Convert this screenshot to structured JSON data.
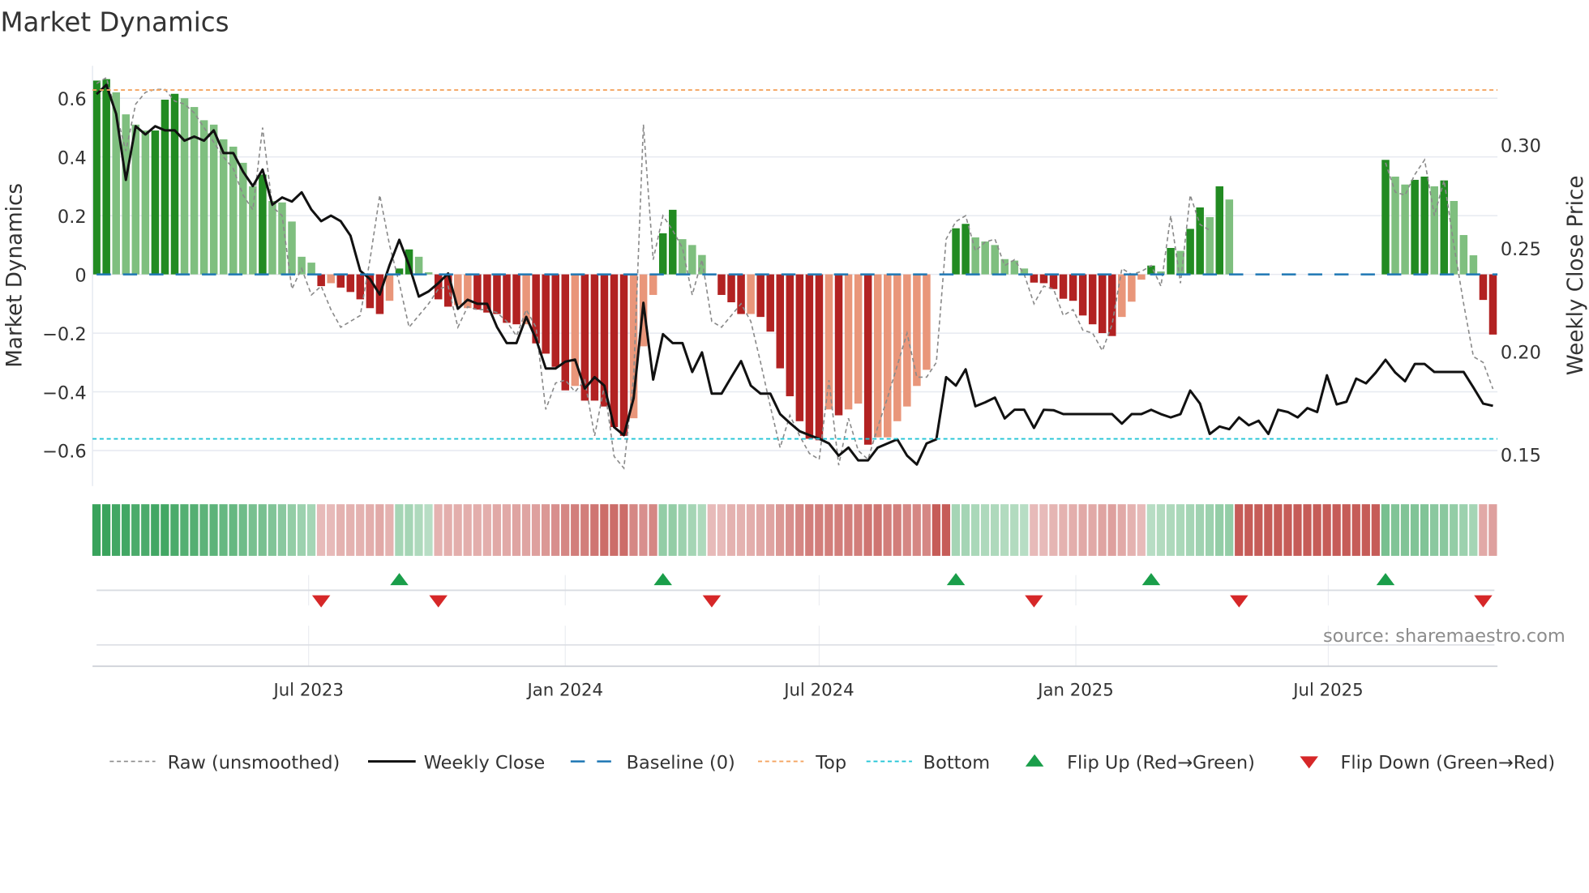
{
  "chart_data": {
    "type": "bar",
    "title": "Market Dynamics",
    "ylabel": "Market Dynamics",
    "y2label": "Weekly Close Price",
    "ylim": [
      -0.72,
      0.71
    ],
    "y2lim": [
      0.135,
      0.338
    ],
    "yticks": [
      0.6,
      0.4,
      0.2,
      0,
      -0.2,
      -0.4,
      -0.6
    ],
    "ytick_labels": [
      "0.6",
      "0.4",
      "0.2",
      "0",
      "−0.2",
      "−0.4",
      "−0.6"
    ],
    "y2ticks": [
      0.3,
      0.25,
      0.2,
      0.15
    ],
    "y2tick_labels": [
      "0.30",
      "0.25",
      "0.20",
      "0.15"
    ],
    "x_start": "2023-01-30",
    "x_freq": "weekly",
    "xticks": [
      "2023-07-01",
      "2024-01-01",
      "2024-07-01",
      "2025-01-01",
      "2025-07-01"
    ],
    "xtick_labels": [
      "Jul 2023",
      "Jan 2024",
      "Jul 2024",
      "Jan 2025",
      "Jul 2025"
    ],
    "grid": true,
    "top_level": 0.628,
    "bottom_level": -0.56,
    "baseline": 0,
    "bars": [
      0.66,
      0.665,
      0.62,
      0.545,
      0.51,
      0.49,
      0.49,
      0.595,
      0.615,
      0.6,
      0.57,
      0.525,
      0.51,
      0.46,
      0.435,
      0.38,
      0.3,
      0.34,
      0.25,
      0.245,
      0.18,
      0.06,
      0.04,
      -0.04,
      -0.03,
      -0.045,
      -0.06,
      -0.085,
      -0.115,
      -0.135,
      -0.09,
      0.02,
      0.085,
      0.06,
      0.007,
      -0.085,
      -0.11,
      -0.105,
      -0.115,
      -0.12,
      -0.13,
      -0.135,
      -0.165,
      -0.17,
      -0.17,
      -0.235,
      -0.27,
      -0.315,
      -0.395,
      -0.38,
      -0.43,
      -0.43,
      -0.45,
      -0.52,
      -0.55,
      -0.49,
      -0.245,
      -0.07,
      0.14,
      0.22,
      0.12,
      0.1,
      0.066,
      -0.003,
      -0.07,
      -0.095,
      -0.135,
      -0.135,
      -0.145,
      -0.195,
      -0.32,
      -0.415,
      -0.5,
      -0.56,
      -0.565,
      -0.46,
      -0.48,
      -0.46,
      -0.44,
      -0.58,
      -0.555,
      -0.555,
      -0.5,
      -0.45,
      -0.38,
      -0.325,
      0,
      0,
      0.157,
      0.172,
      0.126,
      0.112,
      0.1,
      0.052,
      0.047,
      0.02,
      -0.028,
      -0.03,
      -0.05,
      -0.083,
      -0.09,
      -0.14,
      -0.17,
      -0.2,
      -0.21,
      -0.145,
      -0.093,
      -0.018,
      0.03,
      0.01,
      0.09,
      0.08,
      0.155,
      0.228,
      0.195,
      0.3,
      0.255,
      0,
      0,
      0,
      0,
      0,
      0,
      0,
      0,
      0,
      0,
      0,
      0,
      0,
      0,
      0,
      0.39,
      0.333,
      0.306,
      0.322,
      0.333,
      0.3,
      0.32,
      0.25,
      0.134,
      0.065,
      -0.087,
      -0.205
    ],
    "bar_strong": [
      1,
      1,
      0,
      0,
      0,
      0,
      1,
      1,
      1,
      0,
      0,
      0,
      0,
      0,
      0,
      0,
      0,
      1,
      0,
      0,
      0,
      0,
      0,
      1,
      0,
      1,
      1,
      1,
      1,
      1,
      0,
      1,
      1,
      0,
      0,
      1,
      1,
      0,
      0,
      1,
      1,
      1,
      1,
      1,
      0,
      1,
      1,
      1,
      1,
      0,
      1,
      1,
      1,
      1,
      1,
      0,
      0,
      0,
      1,
      1,
      0,
      0,
      0,
      1,
      1,
      1,
      1,
      0,
      1,
      1,
      1,
      1,
      1,
      1,
      1,
      0,
      1,
      0,
      0,
      1,
      0,
      0,
      0,
      0,
      0,
      0,
      0,
      0,
      1,
      1,
      0,
      0,
      0,
      0,
      0,
      0,
      1,
      1,
      1,
      1,
      1,
      1,
      1,
      1,
      1,
      0,
      0,
      0,
      1,
      0,
      1,
      0,
      1,
      1,
      0,
      1,
      0,
      0,
      0,
      0,
      0,
      0,
      0,
      0,
      0,
      0,
      0,
      0,
      0,
      0,
      0,
      0,
      1,
      0,
      0,
      1,
      1,
      0,
      1,
      0,
      0,
      0,
      1,
      1
    ],
    "raw": [
      0.65,
      0.67,
      0.55,
      0.42,
      0.58,
      0.62,
      0.63,
      0.63,
      0.59,
      0.58,
      0.55,
      0.5,
      0.45,
      0.4,
      0.36,
      0.27,
      0.22,
      0.5,
      0.23,
      0.2,
      -0.05,
      0.02,
      -0.07,
      -0.04,
      -0.12,
      -0.18,
      -0.16,
      -0.14,
      0.05,
      0.27,
      0.1,
      -0.03,
      -0.18,
      -0.14,
      -0.1,
      -0.05,
      -0.04,
      -0.18,
      -0.11,
      -0.12,
      -0.12,
      -0.13,
      -0.16,
      -0.21,
      -0.12,
      -0.18,
      -0.46,
      -0.37,
      -0.36,
      -0.4,
      -0.36,
      -0.55,
      -0.38,
      -0.62,
      -0.66,
      -0.35,
      0.51,
      0.05,
      0.2,
      0.15,
      0.09,
      -0.07,
      0.05,
      -0.16,
      -0.18,
      -0.14,
      -0.1,
      -0.16,
      -0.3,
      -0.45,
      -0.59,
      -0.48,
      -0.55,
      -0.61,
      -0.63,
      -0.36,
      -0.65,
      -0.49,
      -0.6,
      -0.63,
      -0.52,
      -0.42,
      -0.31,
      -0.2,
      -0.35,
      -0.35,
      -0.3,
      0.12,
      0.18,
      0.2,
      0.08,
      0.11,
      0.12,
      0.03,
      0.05,
      0.0,
      -0.1,
      -0.04,
      -0.05,
      -0.14,
      -0.12,
      -0.19,
      -0.2,
      -0.26,
      -0.17,
      0.02,
      0.0,
      0.01,
      0.03,
      -0.04,
      0.2,
      -0.03,
      0.27,
      0.17,
      0.15,
      null,
      null,
      null,
      null,
      null,
      null,
      null,
      null,
      null,
      null,
      null,
      null,
      null,
      null,
      null,
      null,
      null,
      0.38,
      0.28,
      0.27,
      0.34,
      0.39,
      0.2,
      0.32,
      0.1,
      -0.1,
      -0.28,
      -0.3,
      -0.39
    ],
    "weekly_close": [
      0.3245,
      0.329,
      0.315,
      0.283,
      0.309,
      0.305,
      0.309,
      0.307,
      0.307,
      0.302,
      0.304,
      0.302,
      0.307,
      0.296,
      0.296,
      0.287,
      0.28,
      0.288,
      0.271,
      0.2745,
      0.2725,
      0.277,
      0.2686,
      0.263,
      0.2657,
      0.263,
      0.256,
      0.239,
      0.235,
      0.2275,
      0.2417,
      0.254,
      0.2417,
      0.2265,
      0.229,
      0.233,
      0.2377,
      0.2206,
      0.225,
      0.223,
      0.223,
      0.2118,
      0.204,
      0.204,
      0.2167,
      0.206,
      0.1917,
      0.1917,
      0.195,
      0.196,
      0.182,
      0.1875,
      0.1834,
      0.1633,
      0.1594,
      0.1773,
      0.2235,
      0.1863,
      0.2083,
      0.204,
      0.204,
      0.19,
      0.1995,
      0.1795,
      0.1795,
      0.1875,
      0.1953,
      0.1834,
      0.1795,
      0.1795,
      0.1696,
      0.1653,
      0.1613,
      0.1594,
      0.1577,
      0.1554,
      0.1495,
      0.1534,
      0.1472,
      0.1472,
      0.1534,
      0.1554,
      0.1574,
      0.1495,
      0.1452,
      0.1554,
      0.1574,
      0.1875,
      0.1834,
      0.1913,
      0.1734,
      0.1753,
      0.1776,
      0.1675,
      0.1717,
      0.1717,
      0.1629,
      0.1717,
      0.1715,
      0.1696,
      0.1696,
      0.1696,
      0.1696,
      0.1696,
      0.1696,
      0.165,
      0.1696,
      0.1696,
      0.1717,
      0.1696,
      0.168,
      0.1696,
      0.181,
      0.1747,
      0.16,
      0.1636,
      0.1623,
      0.168,
      0.1642,
      0.1664,
      0.16,
      0.1717,
      0.1706,
      0.168,
      0.1725,
      0.1706,
      0.1884,
      0.1743,
      0.1756,
      0.1868,
      0.1845,
      0.1897,
      0.1959,
      0.1897,
      0.1855,
      0.1939,
      0.1939,
      0.19,
      0.19,
      0.19,
      0.19,
      0.1825,
      0.1747,
      0.1736
    ],
    "regime_band": [
      0.85,
      0.85,
      0.8,
      0.8,
      0.75,
      0.75,
      0.8,
      0.8,
      0.75,
      0.7,
      0.7,
      0.65,
      0.65,
      0.6,
      0.6,
      0.55,
      0.5,
      0.5,
      0.45,
      0.4,
      0.35,
      0.3,
      0.25,
      -0.15,
      -0.15,
      -0.2,
      -0.2,
      -0.2,
      -0.22,
      -0.25,
      -0.2,
      0.25,
      0.25,
      0.2,
      0.15,
      -0.2,
      -0.22,
      -0.22,
      -0.22,
      -0.22,
      -0.22,
      -0.25,
      -0.25,
      -0.28,
      -0.28,
      -0.3,
      -0.35,
      -0.4,
      -0.45,
      -0.5,
      -0.5,
      -0.55,
      -0.6,
      -0.6,
      -0.6,
      -0.45,
      -0.4,
      -0.45,
      0.35,
      0.35,
      0.3,
      0.25,
      0.2,
      -0.15,
      -0.15,
      -0.2,
      -0.2,
      -0.22,
      -0.25,
      -0.28,
      -0.35,
      -0.4,
      -0.45,
      -0.5,
      -0.5,
      -0.5,
      -0.5,
      -0.5,
      -0.5,
      -0.55,
      -0.55,
      -0.5,
      -0.5,
      -0.45,
      -0.45,
      -0.45,
      -0.7,
      -0.7,
      0.25,
      0.25,
      0.22,
      0.2,
      0.2,
      0.18,
      0.18,
      0.15,
      -0.15,
      -0.15,
      -0.18,
      -0.2,
      -0.22,
      -0.25,
      -0.25,
      -0.28,
      -0.3,
      -0.25,
      -0.2,
      -0.15,
      0.15,
      0.18,
      0.2,
      0.22,
      0.25,
      0.28,
      0.3,
      0.35,
      0.35,
      -0.7,
      -0.7,
      -0.7,
      -0.7,
      -0.7,
      -0.7,
      -0.7,
      -0.7,
      -0.7,
      -0.7,
      -0.7,
      -0.7,
      -0.7,
      -0.7,
      -0.7,
      0.5,
      0.45,
      0.45,
      0.45,
      0.45,
      0.4,
      0.4,
      0.35,
      0.3,
      0.25,
      -0.25,
      -0.3
    ],
    "flips_up": [
      31,
      58,
      88,
      108,
      132
    ],
    "flips_down": [
      23,
      35,
      63,
      96,
      117,
      142
    ],
    "legend": [
      "Raw (unsmoothed)",
      "Weekly Close",
      "Baseline (0)",
      "Top",
      "Bottom",
      "Flip Up (Red→Green)",
      "Flip Down (Green→Red)"
    ],
    "legend_position": "bottom",
    "annotation": "source: sharemaestro.com",
    "colors": {
      "pos_strong": "#228b22",
      "pos_weak": "#7fbf7f",
      "neg_strong": "#b22222",
      "neg_weak": "#e9967a",
      "band_pos": "#1e9646",
      "band_neg": "#b42823",
      "raw": "#8a8a8a",
      "close": "#111111",
      "baseline": "#1f77b4",
      "top": "#f4a460",
      "bottom": "#22c5d6",
      "flip_up": "#1a9e4a",
      "flip_down": "#d62728",
      "grid": "#e6e9f0"
    }
  }
}
